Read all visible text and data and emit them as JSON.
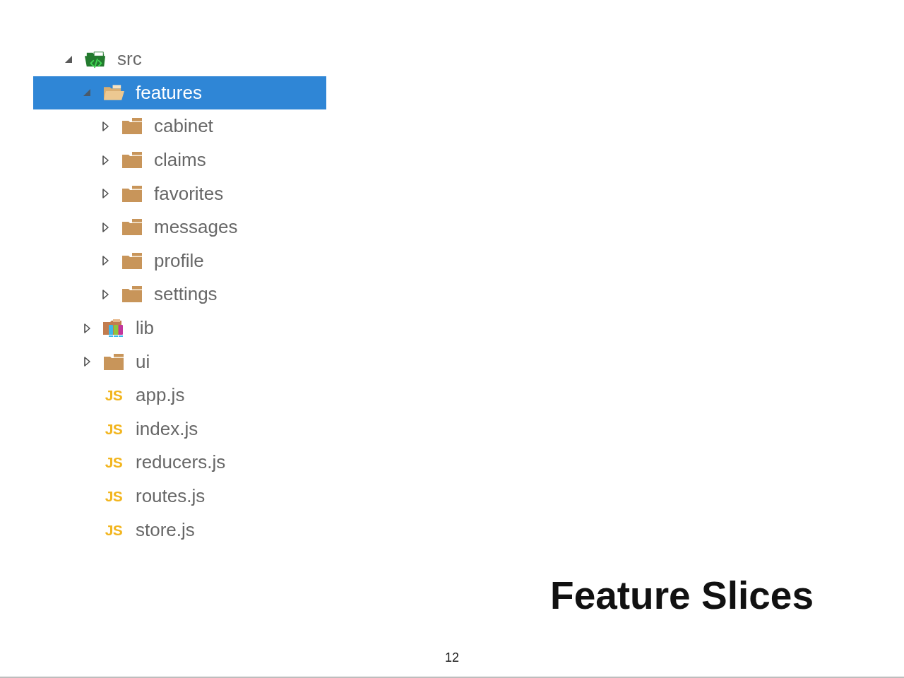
{
  "tree": [
    {
      "kind": "source-folder",
      "label": "src",
      "expanded": true,
      "selected": false,
      "children": [
        {
          "kind": "folder",
          "label": "features",
          "expanded": true,
          "selected": true,
          "children": [
            {
              "kind": "folder",
              "label": "cabinet",
              "expanded": false,
              "selected": false
            },
            {
              "kind": "folder",
              "label": "claims",
              "expanded": false,
              "selected": false
            },
            {
              "kind": "folder",
              "label": "favorites",
              "expanded": false,
              "selected": false
            },
            {
              "kind": "folder",
              "label": "messages",
              "expanded": false,
              "selected": false
            },
            {
              "kind": "folder",
              "label": "profile",
              "expanded": false,
              "selected": false
            },
            {
              "kind": "folder",
              "label": "settings",
              "expanded": false,
              "selected": false
            }
          ]
        },
        {
          "kind": "library-folder",
          "label": "lib",
          "expanded": false,
          "selected": false
        },
        {
          "kind": "folder",
          "label": "ui",
          "expanded": false,
          "selected": false
        },
        {
          "kind": "file",
          "badge": "JS",
          "label": "app.js",
          "selected": false
        },
        {
          "kind": "file",
          "badge": "JS",
          "label": "index.js",
          "selected": false
        },
        {
          "kind": "file",
          "badge": "JS",
          "label": "reducers.js",
          "selected": false
        },
        {
          "kind": "file",
          "badge": "JS",
          "label": "routes.js",
          "selected": false
        },
        {
          "kind": "file",
          "badge": "JS",
          "label": "store.js",
          "selected": false
        }
      ]
    }
  ],
  "slide": {
    "title": "Feature Slices",
    "page_number": "12"
  }
}
